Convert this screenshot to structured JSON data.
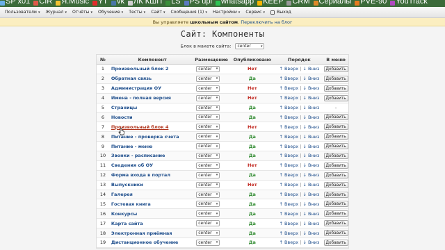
{
  "bookmarks": [
    {
      "label": "SP x01",
      "color": "#6ab0e8"
    },
    {
      "label": "CIR",
      "color": "#e05a4a"
    },
    {
      "label": "Я.Music",
      "color": "#f2c232"
    },
    {
      "label": "YT",
      "color": "#e22b2b"
    },
    {
      "label": "vk",
      "color": "#4a76a8"
    },
    {
      "label": "ЛК КШП",
      "color": "#d0d0d0"
    },
    {
      "label": "LS",
      "color": "#3a8f3a"
    },
    {
      "label": "PS upl",
      "color": "#5a7ac0"
    },
    {
      "label": "whatsapp",
      "color": "#2dc353"
    },
    {
      "label": "KEEP",
      "color": "#f5b400"
    },
    {
      "label": "CRM",
      "color": "#999999"
    },
    {
      "label": "Сериалы",
      "color": "#e08a2a"
    },
    {
      "label": "PVE-90",
      "color": "#e57b1f"
    },
    {
      "label": "YouTrack",
      "color": "#b04ac0"
    }
  ],
  "menu": [
    {
      "label": "Пользователи",
      "caret": "▾"
    },
    {
      "label": "Журнал",
      "caret": "▾"
    },
    {
      "label": "Отчёты",
      "caret": "▾"
    },
    {
      "label": "Обучение",
      "caret": "▾"
    },
    {
      "label": "Тесты",
      "caret": "▾"
    },
    {
      "label": "Сайт",
      "caret": "▾"
    },
    {
      "label": "Сообщения (1)",
      "caret": "▾"
    },
    {
      "label": "Настройки",
      "caret": "▾"
    },
    {
      "label": "Сервис",
      "caret": "▾"
    },
    {
      "label": "Выход",
      "caret": ""
    }
  ],
  "notice": {
    "prefix": "Вы управляете",
    "strong": "школьным сайтом",
    "link": "Переключить на блог"
  },
  "page_title": "Сайт: Компоненты",
  "layout": {
    "label": "Блок в макете сайта:",
    "value": "center"
  },
  "table": {
    "headers": {
      "num": "№",
      "name": "Компонент",
      "place": "Размещение",
      "pub": "Опубликовано",
      "order": "Порядок",
      "menu": "В меню"
    },
    "up": "↑ Вверх",
    "down": "↓ Вниз",
    "sep": "|",
    "rows": [
      {
        "num": "1",
        "name": "Произвольный блок 2",
        "place": "center",
        "pub": "Нет",
        "pub_state": "no",
        "menu": "Добавить"
      },
      {
        "num": "2",
        "name": "Обратная связь",
        "place": "center",
        "pub": "Да",
        "pub_state": "yes",
        "menu": "Добавить"
      },
      {
        "num": "3",
        "name": "Администрация ОУ",
        "place": "center",
        "pub": "Нет",
        "pub_state": "no",
        "menu": "Добавить"
      },
      {
        "num": "4",
        "name": "Имена - полная версия",
        "place": "center",
        "pub": "Нет",
        "pub_state": "no",
        "menu": "Добавить"
      },
      {
        "num": "5",
        "name": "Страницы",
        "place": "center",
        "pub": "Да",
        "pub_state": "yes",
        "menu": "-"
      },
      {
        "num": "6",
        "name": "Новости",
        "place": "center",
        "pub": "Да",
        "pub_state": "yes",
        "menu": "Добавить"
      },
      {
        "num": "7",
        "name": "Произвольный блок 4",
        "place": "center",
        "pub": "Нет",
        "pub_state": "no",
        "menu": "Добавить",
        "active": true
      },
      {
        "num": "8",
        "name": "Питание - проверка счета",
        "place": "center",
        "pub": "Да",
        "pub_state": "yes",
        "menu": "Добавить"
      },
      {
        "num": "9",
        "name": "Питание - меню",
        "place": "center",
        "pub": "Да",
        "pub_state": "yes",
        "menu": "Добавить"
      },
      {
        "num": "10",
        "name": "Звонки - расписание",
        "place": "center",
        "pub": "Да",
        "pub_state": "yes",
        "menu": "Добавить"
      },
      {
        "num": "11",
        "name": "Сведения об ОУ",
        "place": "center",
        "pub": "Нет",
        "pub_state": "no",
        "menu": "Добавить"
      },
      {
        "num": "12",
        "name": "Форма входа в портал",
        "place": "center",
        "pub": "Да",
        "pub_state": "yes",
        "menu": "Добавить"
      },
      {
        "num": "13",
        "name": "Выпускники",
        "place": "center",
        "pub": "Нет",
        "pub_state": "no",
        "menu": "Добавить"
      },
      {
        "num": "14",
        "name": "Галерея",
        "place": "center",
        "pub": "Да",
        "pub_state": "yes",
        "menu": "Добавить"
      },
      {
        "num": "15",
        "name": "Гостевая книга",
        "place": "center",
        "pub": "Да",
        "pub_state": "yes",
        "menu": "Добавить"
      },
      {
        "num": "16",
        "name": "Конкурсы",
        "place": "center",
        "pub": "Да",
        "pub_state": "yes",
        "menu": "Добавить"
      },
      {
        "num": "17",
        "name": "Карта сайта",
        "place": "center",
        "pub": "Да",
        "pub_state": "yes",
        "menu": "Добавить"
      },
      {
        "num": "18",
        "name": "Электронная приёмная",
        "place": "center",
        "pub": "Да",
        "pub_state": "yes",
        "menu": "Добавить"
      },
      {
        "num": "19",
        "name": "Дистанционное обучение",
        "place": "center",
        "pub": "Да",
        "pub_state": "yes",
        "menu": "Добавить"
      }
    ]
  }
}
